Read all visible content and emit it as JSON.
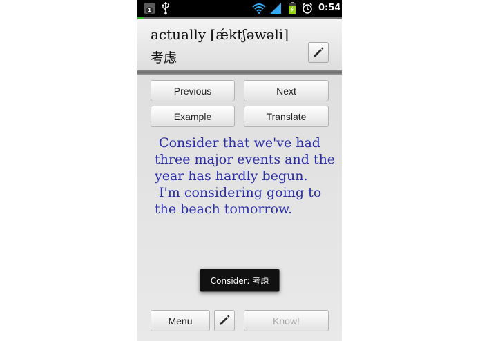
{
  "status_bar": {
    "notification_count": "1",
    "time": "0:54",
    "icons": [
      "notification-icon",
      "usb-icon",
      "wifi-icon",
      "signal-icon",
      "battery-icon",
      "alarm-icon"
    ]
  },
  "progress": {
    "fraction": 0.03,
    "color": "#2fb52f"
  },
  "card": {
    "word": "actually [ǽktʃəwəli]",
    "translation": "考虑"
  },
  "buttons": {
    "previous": "Previous",
    "next": "Next",
    "example": "Example",
    "translate": "Translate",
    "menu": "Menu",
    "know": "Know!"
  },
  "examples": {
    "text": " Consider that we've had three major events and the year has hardly begun.\n I'm considering going to the beach tomorrow."
  },
  "toast": {
    "text": "Consider: 考虑"
  },
  "colors": {
    "example_text": "#2b2fa6",
    "status_bar": "#000000"
  }
}
